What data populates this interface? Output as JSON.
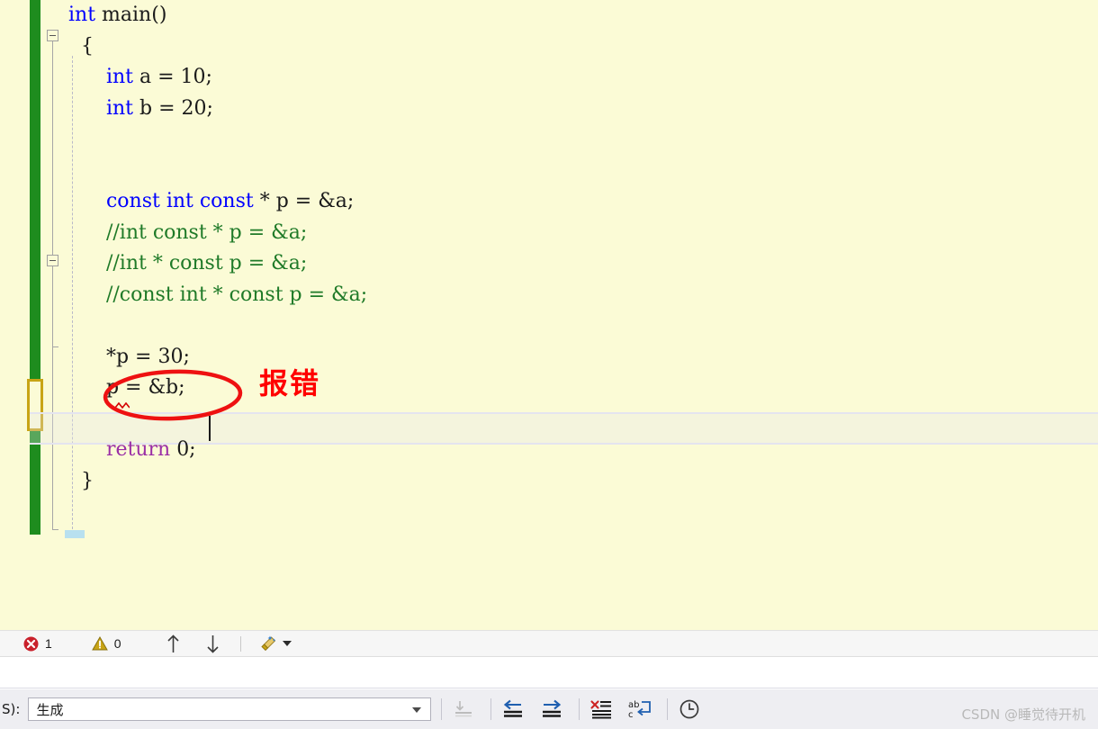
{
  "editor": {
    "background_color": "#fbfbd6",
    "change_bar_color": "#1e8c1e",
    "unsaved_marker_color": "#c8a415",
    "lines": [
      {
        "n": 1,
        "segments": [
          {
            "t": "int ",
            "c": "kw-blue"
          },
          {
            "t": "main()",
            "c": ""
          }
        ]
      },
      {
        "n": 2,
        "segments": [
          {
            "t": "  {",
            "c": ""
          }
        ]
      },
      {
        "n": 3,
        "segments": [
          {
            "t": "      int ",
            "c": "kw-blue"
          },
          {
            "t": "a = 10;",
            "c": ""
          }
        ]
      },
      {
        "n": 4,
        "segments": [
          {
            "t": "      int ",
            "c": "kw-blue"
          },
          {
            "t": "b = 20;",
            "c": ""
          }
        ]
      },
      {
        "n": 5,
        "segments": [
          {
            "t": "",
            "c": ""
          }
        ]
      },
      {
        "n": 6,
        "segments": [
          {
            "t": "",
            "c": ""
          }
        ]
      },
      {
        "n": 7,
        "segments": [
          {
            "t": "      const int const ",
            "c": "kw-blue"
          },
          {
            "t": "* p = &a;",
            "c": ""
          }
        ]
      },
      {
        "n": 8,
        "segments": [
          {
            "t": "      //int const * p = &a;",
            "c": "cmt"
          }
        ]
      },
      {
        "n": 9,
        "segments": [
          {
            "t": "      //int * const p = &a;",
            "c": "cmt"
          }
        ]
      },
      {
        "n": 10,
        "segments": [
          {
            "t": "      //const int * const p = &a;",
            "c": "cmt"
          }
        ]
      },
      {
        "n": 11,
        "segments": [
          {
            "t": "",
            "c": ""
          }
        ]
      },
      {
        "n": 12,
        "segments": [
          {
            "t": "      *p = 30;",
            "c": ""
          }
        ]
      },
      {
        "n": 13,
        "segments": [
          {
            "t": "      p = &b;",
            "c": ""
          }
        ]
      },
      {
        "n": 14,
        "segments": [
          {
            "t": "",
            "c": ""
          }
        ]
      },
      {
        "n": 15,
        "segments": [
          {
            "t": "      return ",
            "c": "kw-purple"
          },
          {
            "t": "0;",
            "c": ""
          }
        ]
      },
      {
        "n": 16,
        "segments": [
          {
            "t": "  }",
            "c": ""
          }
        ]
      }
    ],
    "annotation": {
      "text": "报错",
      "color": "#ff0000",
      "shape": "ellipse-around-*p-=-30;"
    },
    "current_line_text": "p = &b;"
  },
  "error_list": {
    "error_icon": "error-circle-x-icon",
    "error_count": "1",
    "warning_icon": "warning-triangle-icon",
    "warning_count": "0",
    "prev_label": "↑",
    "next_label": "↓",
    "clean_icon": "broom-icon",
    "error_color": "#c9202b",
    "warning_color": "#c8a415"
  },
  "output_toolbar": {
    "source_label": "S):",
    "source_value": "生成",
    "buttons": [
      {
        "name": "go-to-source-icon",
        "disabled": true
      },
      {
        "name": "previous-message-icon",
        "disabled": false
      },
      {
        "name": "next-message-icon",
        "disabled": false
      },
      {
        "name": "clear-all-icon",
        "disabled": false
      },
      {
        "name": "toggle-word-wrap-icon",
        "disabled": false
      },
      {
        "name": "show-timestamps-icon",
        "disabled": false
      }
    ]
  },
  "watermark": {
    "text": "CSDN @睡觉待开机"
  }
}
